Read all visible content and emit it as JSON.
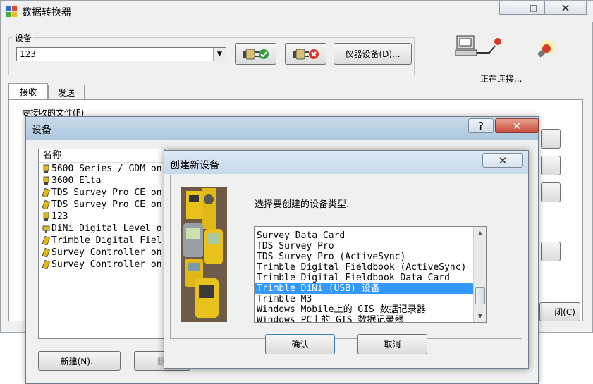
{
  "main": {
    "title": "数据转换器",
    "device_group_label": "设备",
    "device_select_value": "123",
    "instrument_button": "仪器设备(D)...",
    "status_text": "正在连接...",
    "tabs": [
      {
        "label": "接收"
      },
      {
        "label": "发送"
      }
    ],
    "files_group_label": "要接收的文件(F)",
    "close_button_partial": "闭(C)"
  },
  "devices_dialog": {
    "title": "设备",
    "help_glyph": "?",
    "list_header": "名称",
    "items": [
      {
        "label": "5600 Series / GDM on",
        "icon": "survey-instrument-icon"
      },
      {
        "label": "3600 Elta",
        "icon": "survey-instrument-icon"
      },
      {
        "label": "TDS Survey Pro CE on",
        "icon": "handheld-icon"
      },
      {
        "label": "TDS Survey Pro CE on",
        "icon": "handheld-icon"
      },
      {
        "label": "123",
        "icon": "survey-instrument-icon"
      },
      {
        "label": "DiNi Digital Level o",
        "icon": "level-icon"
      },
      {
        "label": "Trimble Digital Fiel",
        "icon": "handheld-icon"
      },
      {
        "label": "Survey Controller on",
        "icon": "handheld-icon"
      },
      {
        "label": "Survey Controller on",
        "icon": "handheld-icon"
      }
    ],
    "new_button": "新建(N)...",
    "delete_button_partial": "删"
  },
  "create_dialog": {
    "title": "创建新设备",
    "prompt": "选择要创建的设备类型.",
    "types": [
      {
        "label": "Survey Data Card",
        "selected": false
      },
      {
        "label": "TDS Survey Pro",
        "selected": false
      },
      {
        "label": "TDS Survey Pro (ActiveSync)",
        "selected": false
      },
      {
        "label": "Trimble Digital Fieldbook (ActiveSync)",
        "selected": false
      },
      {
        "label": "Trimble Digital Fieldbook Data Card",
        "selected": false
      },
      {
        "label": "Trimble DiNi (USB) 设备",
        "selected": true
      },
      {
        "label": "Trimble M3",
        "selected": false
      },
      {
        "label": "Windows Mobile上的 GIS 数据记录器",
        "selected": false
      },
      {
        "label": "Windows PC上的 GIS 数据记录器",
        "selected": false
      }
    ],
    "ok_button": "确认",
    "cancel_button": "取消"
  },
  "colors": {
    "selection": "#3399ff",
    "close_red": "#c94a3a"
  }
}
